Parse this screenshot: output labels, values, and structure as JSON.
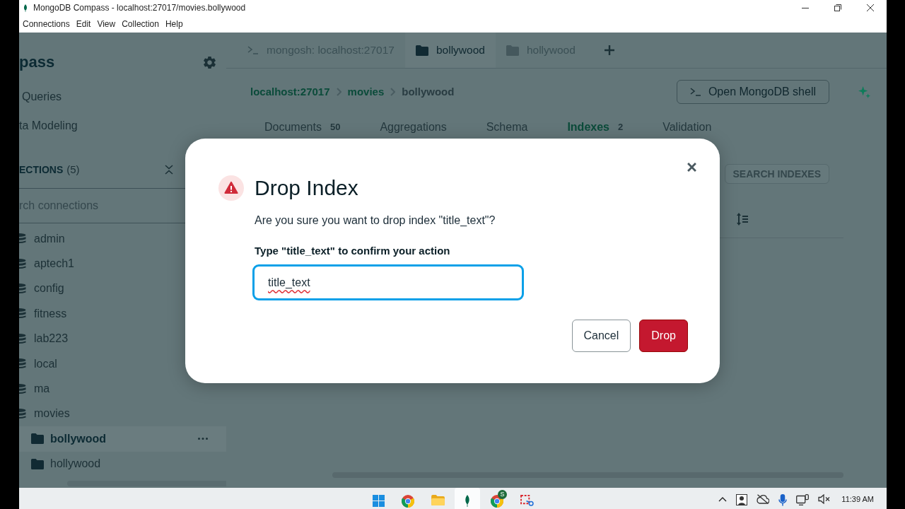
{
  "window": {
    "title": "MongoDB Compass - localhost:27017/movies.bollywood"
  },
  "menu": [
    "Connections",
    "Edit",
    "View",
    "Collection",
    "Help"
  ],
  "sidebar": {
    "app_name": "pass",
    "nav": [
      "Queries",
      "ta Modeling"
    ],
    "section": {
      "label": "ECTIONS",
      "count": "(5)"
    },
    "search": {
      "placeholder": "rch connections"
    },
    "databases": [
      {
        "name": "admin",
        "selected": false
      },
      {
        "name": "aptech1",
        "selected": false
      },
      {
        "name": "config",
        "selected": false
      },
      {
        "name": "fitness",
        "selected": false
      },
      {
        "name": "lab223",
        "selected": false
      },
      {
        "name": "local",
        "selected": false
      },
      {
        "name": "ma",
        "selected": false
      },
      {
        "name": "movies",
        "selected": false,
        "children": [
          {
            "name": "bollywood",
            "selected": true
          },
          {
            "name": "hollywood",
            "selected": false
          }
        ]
      }
    ]
  },
  "tabs": [
    {
      "kind": "shell",
      "label": "mongosh: localhost:27017",
      "selected": false
    },
    {
      "kind": "collection",
      "label": "bollywood",
      "selected": true
    },
    {
      "kind": "collection",
      "label": "hollywood",
      "selected": false
    }
  ],
  "breadcrumb": [
    "localhost:27017",
    "movies",
    "bollywood"
  ],
  "shell_button": {
    "label": "Open MongoDB shell"
  },
  "collection_tabs": [
    {
      "label": "Documents",
      "count": "50",
      "selected": false
    },
    {
      "label": "Aggregations",
      "selected": false
    },
    {
      "label": "Schema",
      "selected": false
    },
    {
      "label": "Indexes",
      "count": "2",
      "selected": true
    },
    {
      "label": "Validation",
      "selected": false
    }
  ],
  "indexes_toolbar": {
    "search_indexes_button": {
      "label": "SEARCH INDEXES",
      "disabled": true
    }
  },
  "dialog": {
    "title": "Drop Index",
    "message": "Are you sure you want to drop index \"title_text\"?",
    "confirm_label": "Type \"title_text\" to confirm your action",
    "input": {
      "value": "title_text",
      "focused": true,
      "misspelled": true
    },
    "buttons": [
      {
        "kind": "secondary",
        "label": "Cancel"
      },
      {
        "kind": "danger",
        "label": "Drop"
      }
    ]
  },
  "taskbar": {
    "apps": [
      {
        "kind": "start",
        "active": false
      },
      {
        "kind": "browser",
        "active": false
      },
      {
        "kind": "files",
        "active": false
      },
      {
        "kind": "leaf",
        "active": true
      },
      {
        "kind": "browser",
        "active": false,
        "badge": "S"
      },
      {
        "kind": "snip",
        "active": false
      }
    ],
    "time": "11:39 AM"
  }
}
